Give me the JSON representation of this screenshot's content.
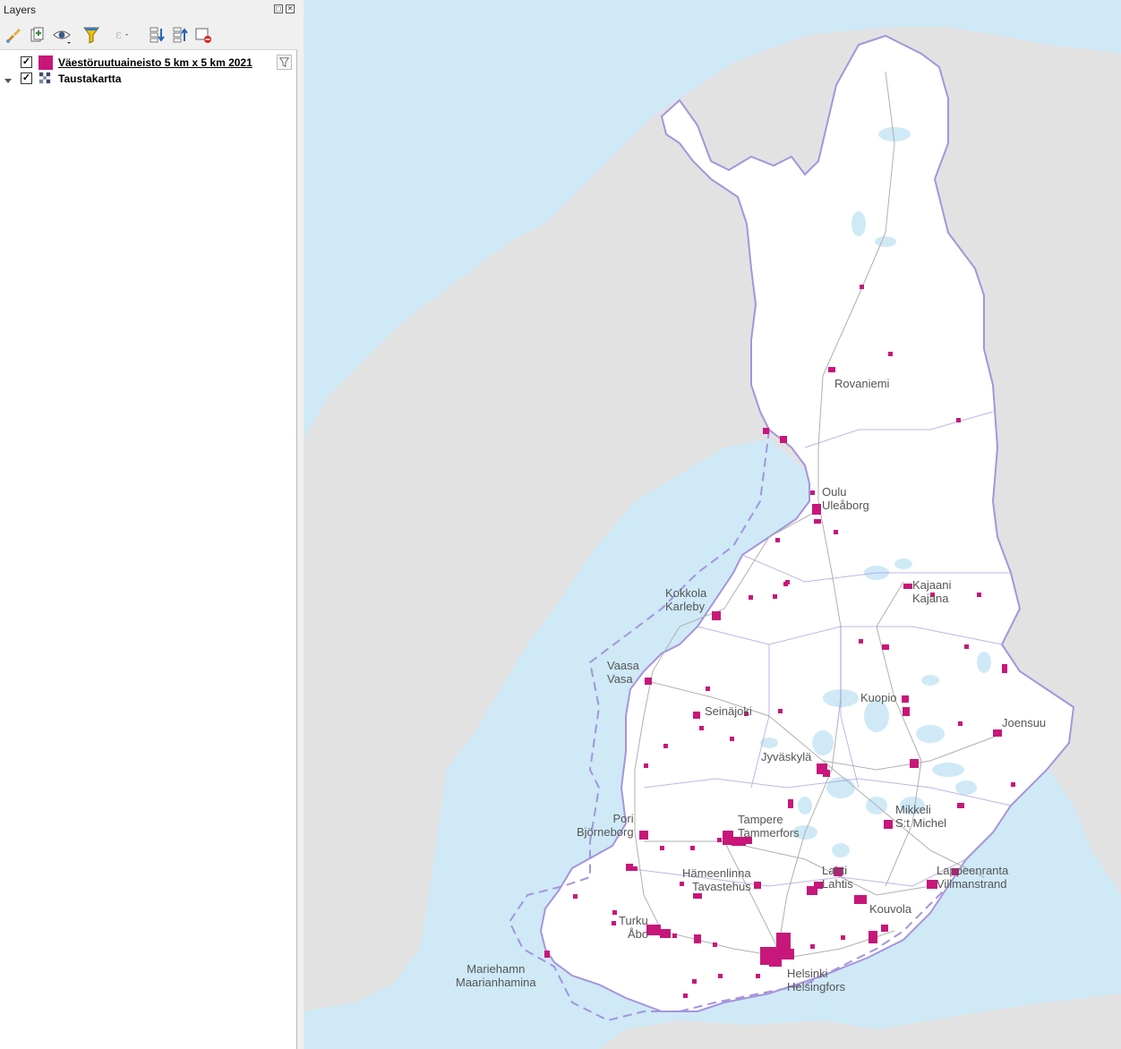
{
  "panel": {
    "title": "Layers",
    "toolbar_icons": [
      "open-layer-styling-icon",
      "add-group-icon",
      "manage-visibility-icon",
      "filter-legend-icon",
      "filter-by-expression-icon",
      "expand-all-icon",
      "collapse-all-icon",
      "remove-layer-icon"
    ]
  },
  "layers": [
    {
      "name": "Väestöruutuaineisto 5 km x 5 km 2021",
      "checked": true,
      "symbol_color": "#c7177a"
    },
    {
      "name": "Taustakartta",
      "checked": true
    }
  ],
  "map": {
    "colors": {
      "sea": "#cfe9f7",
      "land_other": "#e2e2e2",
      "finland": "#ffffff",
      "border": "#a594dc",
      "grid": "#c7177a"
    },
    "cities": [
      {
        "id": "rovaniemi",
        "lines": [
          "Rovaniemi"
        ]
      },
      {
        "id": "oulu",
        "lines": [
          "Oulu",
          "Uleåborg"
        ]
      },
      {
        "id": "kajaani",
        "lines": [
          "Kajaani",
          "Kajana"
        ]
      },
      {
        "id": "kokkola",
        "lines": [
          "Kokkola",
          "Karleby"
        ]
      },
      {
        "id": "vaasa",
        "lines": [
          "Vaasa",
          "Vasa"
        ]
      },
      {
        "id": "seinajoki",
        "lines": [
          "Seinäjoki"
        ]
      },
      {
        "id": "kuopio",
        "lines": [
          "Kuopio"
        ]
      },
      {
        "id": "joensuu",
        "lines": [
          "Joensuu"
        ]
      },
      {
        "id": "jyvaskyla",
        "lines": [
          "Jyväskylä"
        ]
      },
      {
        "id": "pori",
        "lines": [
          "Pori",
          "Björneborg"
        ]
      },
      {
        "id": "tampere",
        "lines": [
          "Tampere",
          "Tammerfors"
        ]
      },
      {
        "id": "mikkeli",
        "lines": [
          "Mikkeli",
          "S:t Michel"
        ]
      },
      {
        "id": "hameenlinna",
        "lines": [
          "Hämeenlinna",
          "Tavastehus"
        ]
      },
      {
        "id": "lahti",
        "lines": [
          "Lahti",
          "Lahtis"
        ]
      },
      {
        "id": "lappeenranta",
        "lines": [
          "Lappeenranta",
          "Villmanstrand"
        ]
      },
      {
        "id": "kouvola",
        "lines": [
          "Kouvola"
        ]
      },
      {
        "id": "turku",
        "lines": [
          "Turku",
          "Åbo"
        ]
      },
      {
        "id": "mariehamn",
        "lines": [
          "Mariehamn",
          "Maarianhamina"
        ]
      },
      {
        "id": "helsinki",
        "lines": [
          "Helsinki",
          "Helsingfors"
        ]
      }
    ]
  }
}
